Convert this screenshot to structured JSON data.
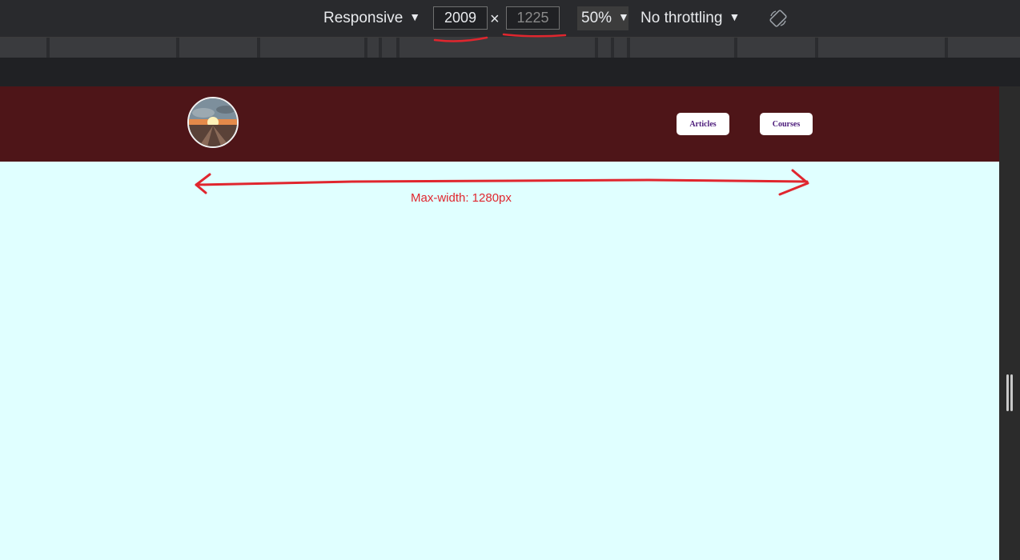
{
  "devtools": {
    "device_label": "Responsive",
    "width_value": "2009",
    "height_value": "1225",
    "times_symbol": "×",
    "zoom_label": "50%",
    "throttling_label": "No throttling",
    "caret": "▼"
  },
  "site": {
    "nav": {
      "articles_label": "Articles",
      "courses_label": "Courses"
    }
  },
  "annotation": {
    "text": "Max-width: 1280px",
    "color": "#e0262e"
  },
  "colors": {
    "header_bg": "#4e1518",
    "page_bg": "#e0ffff",
    "nav_text": "#4b1a7a"
  }
}
